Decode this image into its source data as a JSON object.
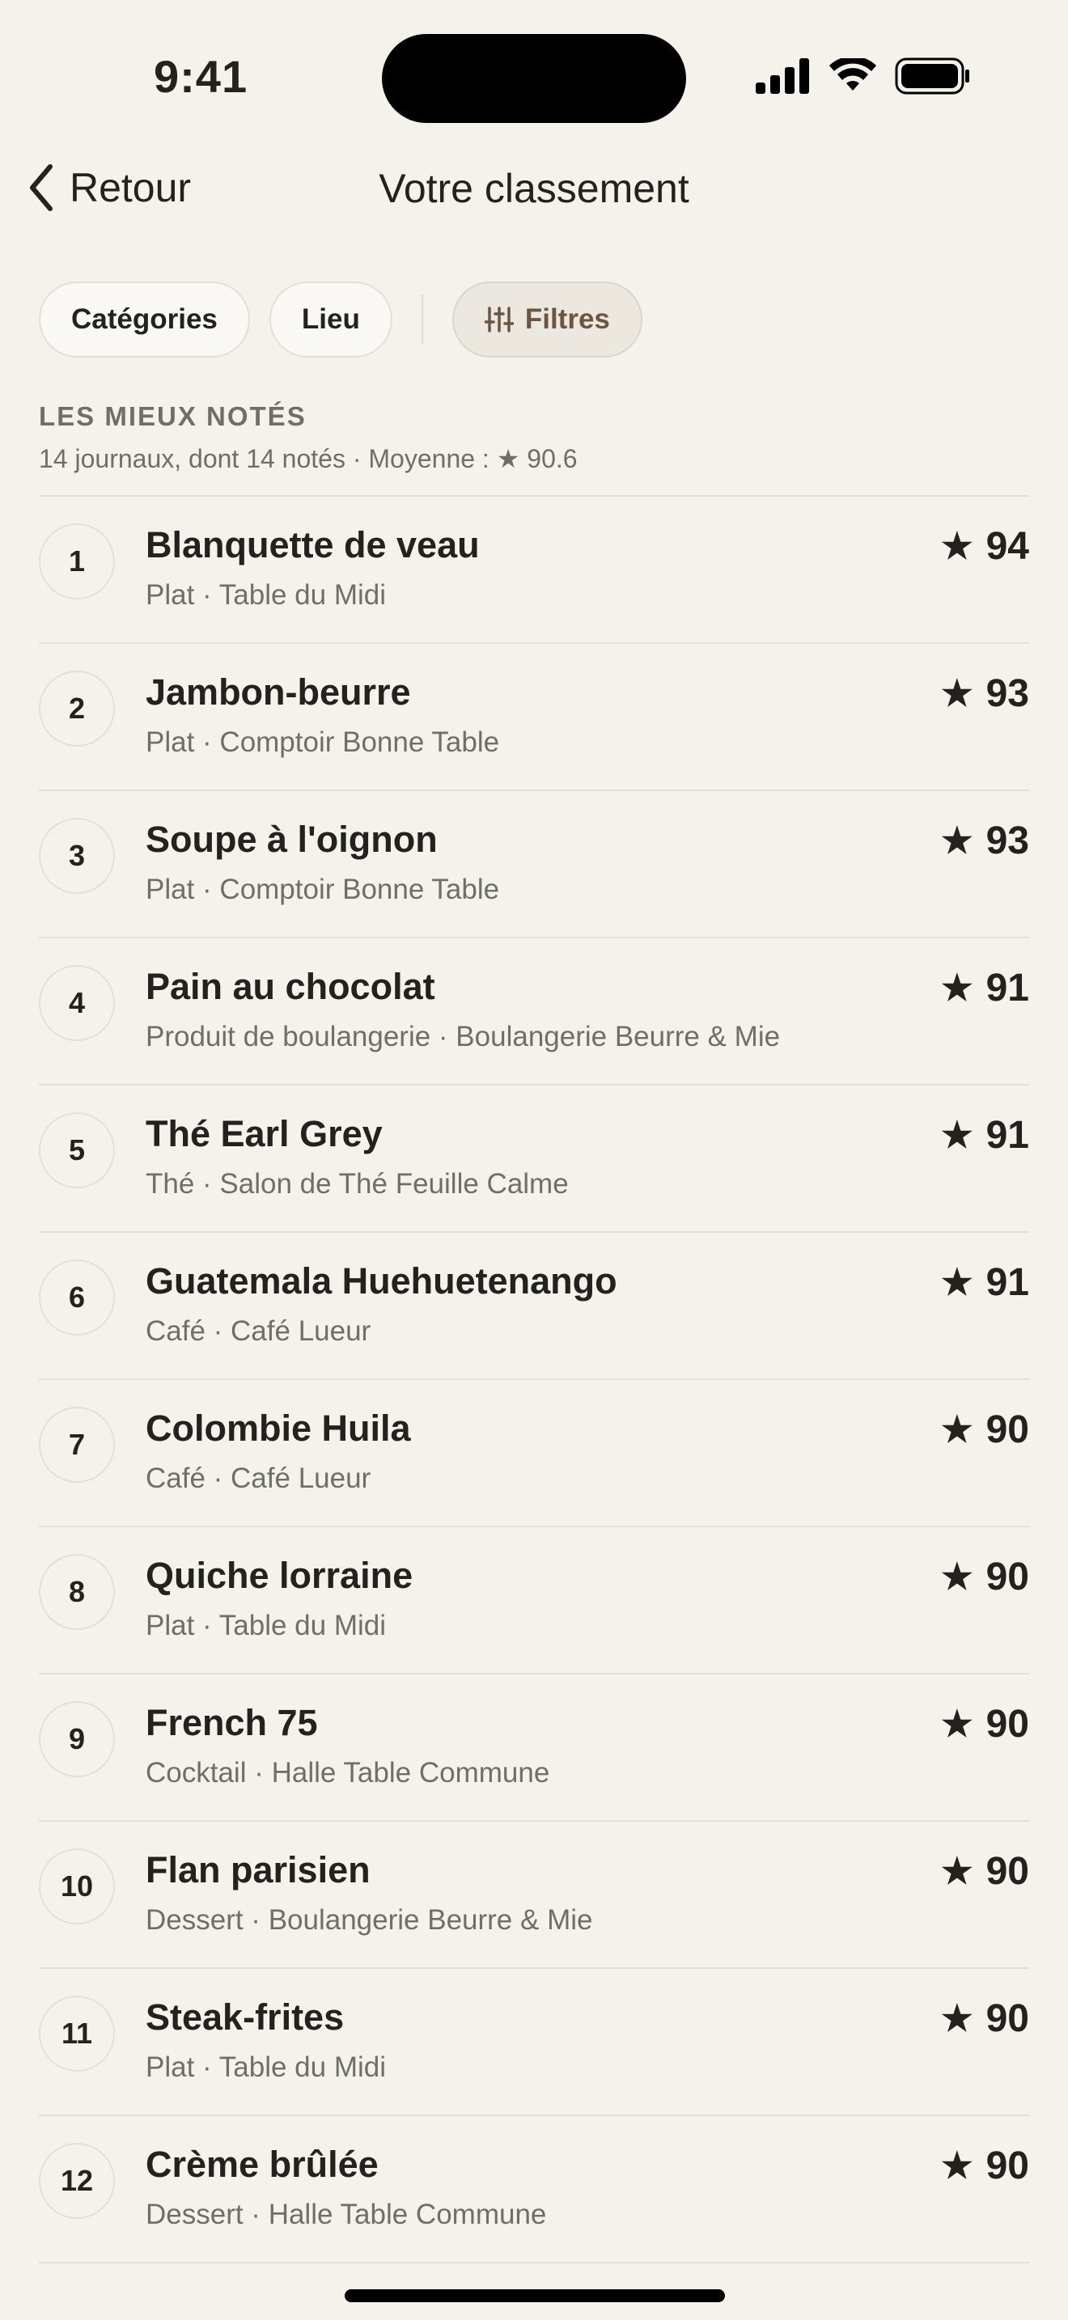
{
  "status_bar": {
    "time": "9:41"
  },
  "nav": {
    "back_label": "Retour",
    "title": "Votre classement"
  },
  "chips": {
    "categories": "Catégories",
    "location": "Lieu",
    "filters": "Filtres"
  },
  "section": {
    "title": "LES MIEUX NOTÉS",
    "summary": "14 journaux, dont 14 notés · Moyenne : ★ 90.6"
  },
  "score_star": "★",
  "items": [
    {
      "rank": "1",
      "name": "Blanquette de veau",
      "meta": "Plat · Table du Midi",
      "score": "94"
    },
    {
      "rank": "2",
      "name": "Jambon-beurre",
      "meta": "Plat · Comptoir Bonne Table",
      "score": "93"
    },
    {
      "rank": "3",
      "name": "Soupe à l'oignon",
      "meta": "Plat · Comptoir Bonne Table",
      "score": "93"
    },
    {
      "rank": "4",
      "name": "Pain au chocolat",
      "meta": "Produit de boulangerie · Boulangerie Beurre & Mie",
      "score": "91"
    },
    {
      "rank": "5",
      "name": "Thé Earl Grey",
      "meta": "Thé · Salon de Thé Feuille Calme",
      "score": "91"
    },
    {
      "rank": "6",
      "name": "Guatemala Huehuetenango",
      "meta": "Café · Café Lueur",
      "score": "91"
    },
    {
      "rank": "7",
      "name": "Colombie Huila",
      "meta": "Café · Café Lueur",
      "score": "90"
    },
    {
      "rank": "8",
      "name": "Quiche lorraine",
      "meta": "Plat · Table du Midi",
      "score": "90"
    },
    {
      "rank": "9",
      "name": "French 75",
      "meta": "Cocktail · Halle Table Commune",
      "score": "90"
    },
    {
      "rank": "10",
      "name": "Flan parisien",
      "meta": "Dessert · Boulangerie Beurre & Mie",
      "score": "90"
    },
    {
      "rank": "11",
      "name": "Steak-frites",
      "meta": "Plat · Table du Midi",
      "score": "90"
    },
    {
      "rank": "12",
      "name": "Crème brûlée",
      "meta": "Dessert · Halle Table Commune",
      "score": "90"
    }
  ]
}
